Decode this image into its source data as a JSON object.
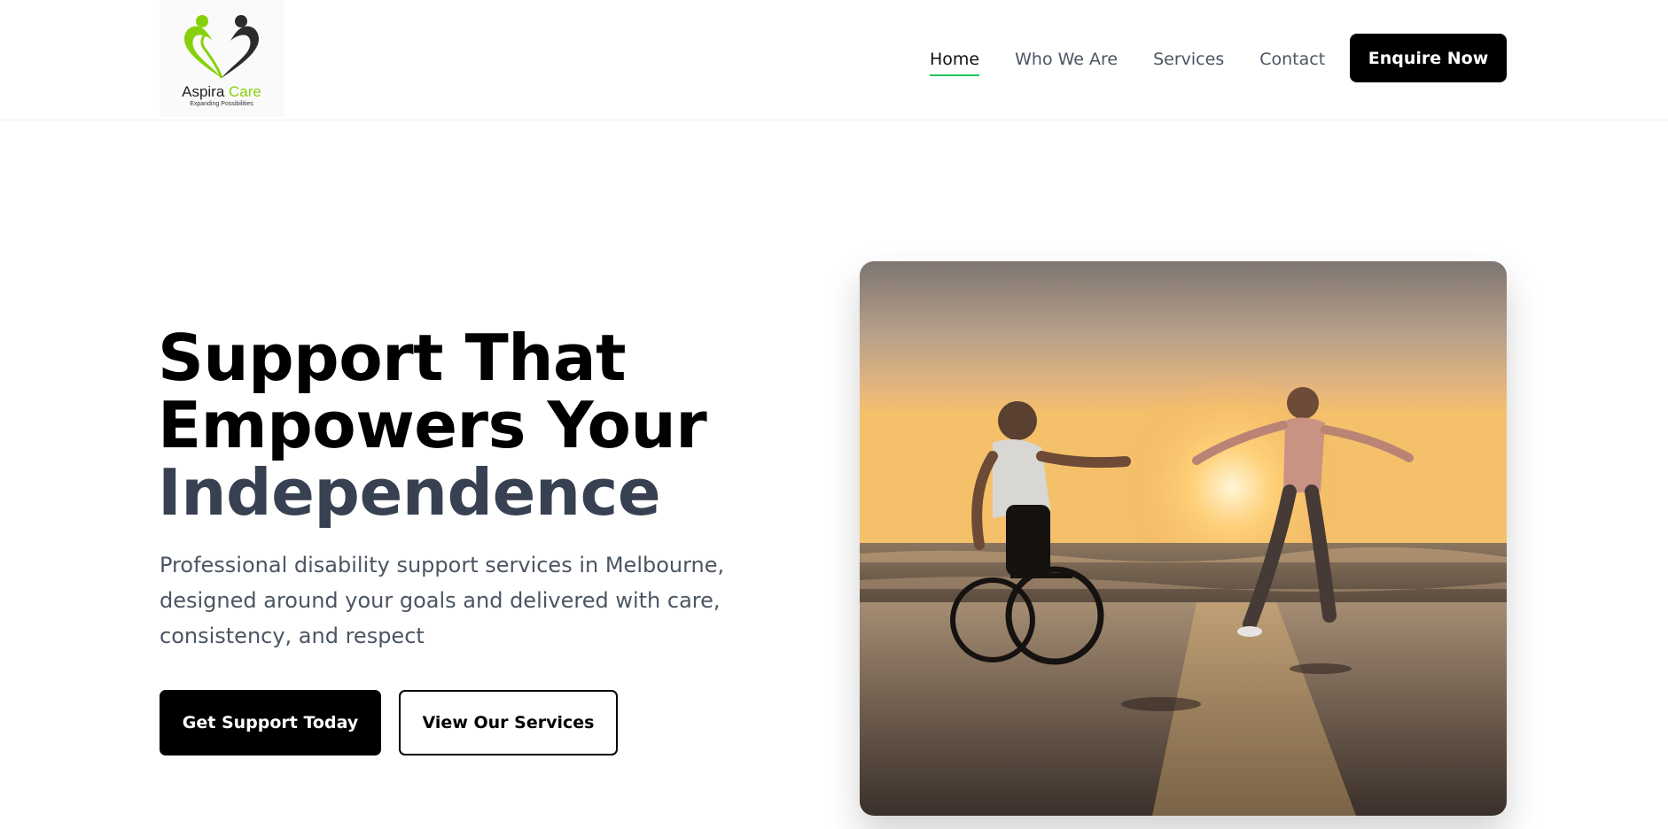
{
  "brand": {
    "name_part1": "Aspira",
    "name_part2": "Care",
    "tagline": "Expanding Possibilities",
    "logo_icon": "heart-people-logo",
    "accent_color": "#86d10c"
  },
  "nav": {
    "items": [
      {
        "label": "Home",
        "active": true
      },
      {
        "label": "Who We Are",
        "active": false
      },
      {
        "label": "Services",
        "active": false
      },
      {
        "label": "Contact",
        "active": false
      }
    ],
    "cta_label": "Enquire Now",
    "active_underline_color": "#22c55e"
  },
  "hero": {
    "title_line1": "Support That",
    "title_line2": "Empowers Your",
    "title_highlight": "Independence",
    "subtitle": "Professional disability support services in Melbourne, designed around your goals and delivered with care, consistency, and respect",
    "primary_button": "Get Support Today",
    "secondary_button": "View Our Services",
    "image_icon": "beach-sunset-wheelchair-photo"
  }
}
